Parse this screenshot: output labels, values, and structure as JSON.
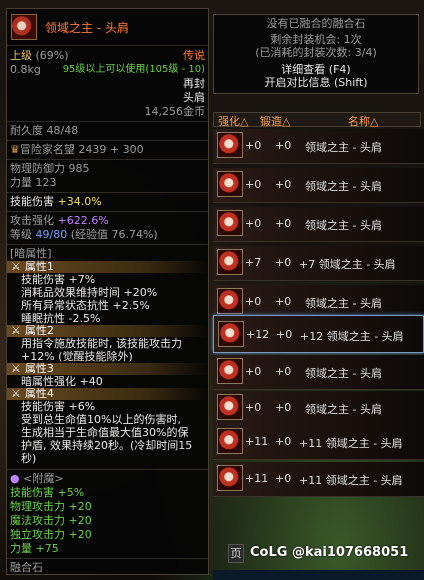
{
  "item": {
    "name": "领域之主 - 头肩",
    "grade": "上级",
    "grade_pct": "(69%)",
    "rarity": "传说",
    "weight": "0.8kg",
    "level_req": "95级以上可以使用(105级 - 10)",
    "trade": "再封",
    "slot": "头肩",
    "price": "14,256金币",
    "durability": "耐久度 48/48",
    "fame": "冒险家名望 2439 + 300",
    "phys_def": "物理防御力 985",
    "strength": "力量 123",
    "skill_dmg": "技能伤害",
    "skill_dmg_val": "+34.0%",
    "attack_boost": "攻击强化",
    "attack_boost_val": "+622.6%",
    "level_label": "等级",
    "level_val": "49/80",
    "exp": "(经验值 76.74%)",
    "dark_header": "[暗属性]",
    "attrs": [
      {
        "title": "属性1",
        "lines": [
          "技能伤害 +7%",
          "消耗品效果维持时间 +20%",
          "所有异常状态抗性 +2.5%",
          "睡眠抗性 -2.5%"
        ]
      },
      {
        "title": "属性2",
        "lines": [
          "用指令施放技能时, 该技能攻击力",
          "+12% (觉醒技能除外)"
        ]
      },
      {
        "title": "属性3",
        "lines": [
          "暗属性强化 +40"
        ]
      },
      {
        "title": "属性4",
        "lines": [
          "技能伤害 +6%",
          "受到总生命值10%以上的伤害时,",
          "生成相当于生命值最大值30%的保",
          "护盾, 效果持续20秒。(冷却时间15",
          "秒)"
        ]
      }
    ],
    "enchant_header": "<附魔>",
    "enchant": [
      "技能伤害 +5%",
      "物理攻击力 +20",
      "魔法攻击力 +20",
      "独立攻击力 +20",
      "力量 +75"
    ],
    "bottom_hint": "融合石"
  },
  "panel": {
    "line1": "没有已融合的融合石",
    "line2": "剩余封装机会: 1次",
    "line3": "(已消耗的封装次数: 3/4)",
    "line4": "详细查看 (F4)",
    "line5": "开启对比信息 (Shift)"
  },
  "list_header": {
    "col1": "强化△",
    "col2": "锻造△",
    "col3": "名称△"
  },
  "list": [
    {
      "enh": "+0",
      "forge": "+0",
      "name": "领域之主 - 头肩"
    },
    {
      "enh": "+0",
      "forge": "+0",
      "name": "领域之主 - 头肩"
    },
    {
      "enh": "+0",
      "forge": "+0",
      "name": "领域之主 - 头肩"
    },
    {
      "enh": "+7",
      "forge": "+0",
      "name": "+7 领域之主 - 头肩"
    },
    {
      "enh": "+0",
      "forge": "+0",
      "name": "领域之主 - 头肩"
    },
    {
      "enh": "+12",
      "forge": "+0",
      "name": "+12 领域之主 - 头肩"
    },
    {
      "enh": "+0",
      "forge": "+0",
      "name": "领域之主 - 头肩"
    },
    {
      "enh": "+0",
      "forge": "+0",
      "name": "领域之主 - 头肩"
    },
    {
      "enh": "+11",
      "forge": "+0",
      "name": "+11 领域之主 - 头肩"
    },
    {
      "enh": "+11",
      "forge": "+0",
      "name": "+11 领域之主 - 头肩"
    }
  ],
  "watermark": "CoLG @kai107668051",
  "page_btn": "页"
}
